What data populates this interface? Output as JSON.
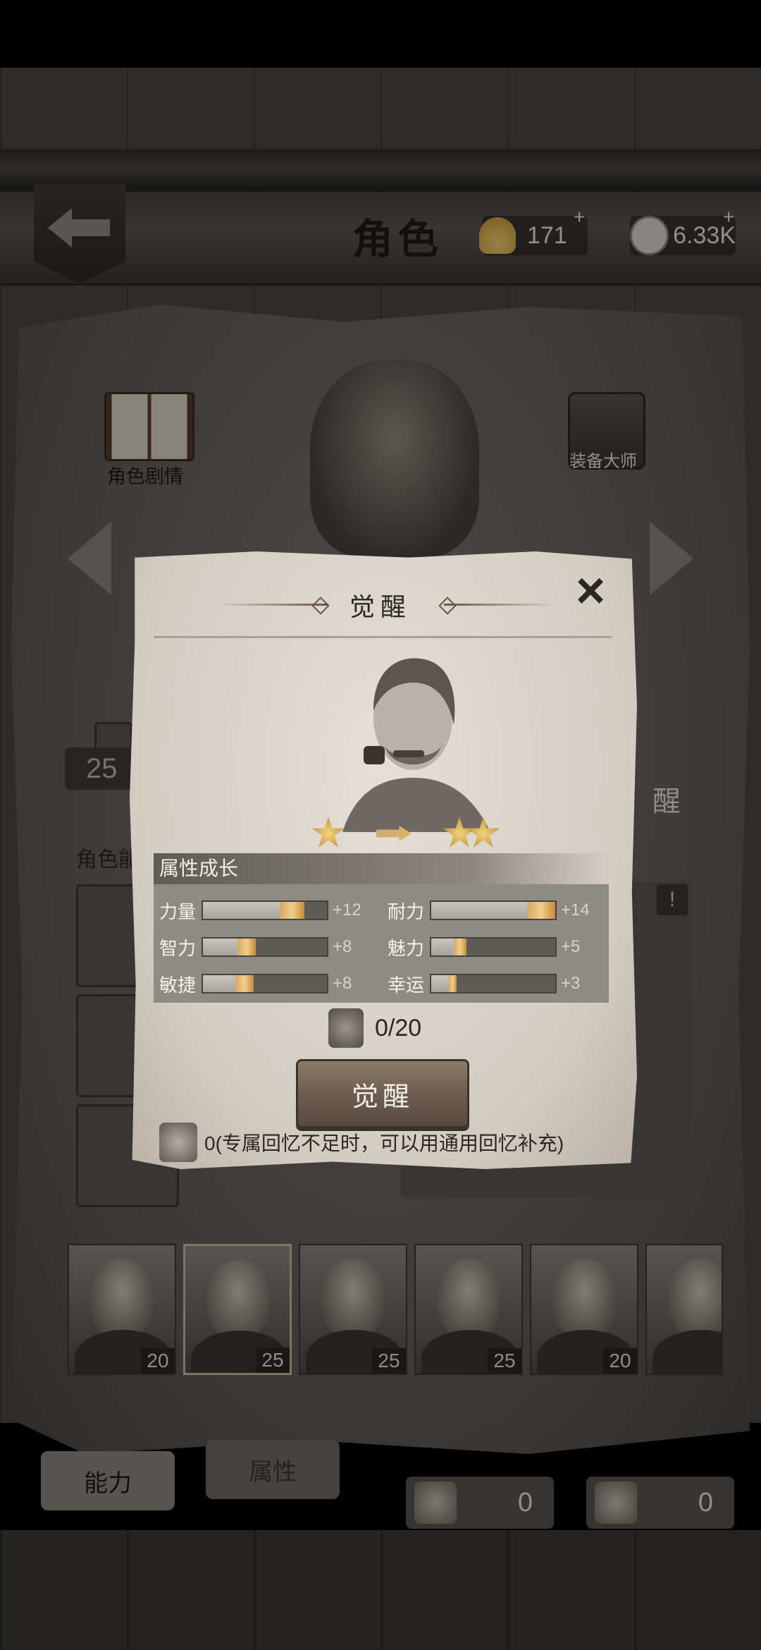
{
  "header": {
    "title": "角色",
    "shells": "171",
    "coins": "6.33K",
    "plus": "+"
  },
  "side": {
    "story_label": "角色剧情",
    "equip_label": "装备大师"
  },
  "background_ui": {
    "level_badge": "25",
    "ability_label": "角色能",
    "awaken_partial": "醒",
    "alert": "!"
  },
  "roster": [
    {
      "level": "20"
    },
    {
      "level": "25"
    },
    {
      "level": "25"
    },
    {
      "level": "25"
    },
    {
      "level": "20"
    },
    {
      "level": ""
    }
  ],
  "bottom": {
    "tab_ability": "能力",
    "tab_attr": "属性",
    "counter_1": "0",
    "counter_2": "0"
  },
  "modal": {
    "title": "觉醒",
    "close": "×",
    "attr_header": "属性成长",
    "stars_from": 1,
    "stars_to": 2,
    "attributes": [
      {
        "label": "力量",
        "bonus": "+12",
        "base": 0.62,
        "gain": 0.2
      },
      {
        "label": "耐力",
        "bonus": "+14",
        "base": 0.77,
        "gain": 0.23
      },
      {
        "label": "智力",
        "bonus": "+8",
        "base": 0.28,
        "gain": 0.15
      },
      {
        "label": "魅力",
        "bonus": "+5",
        "base": 0.18,
        "gain": 0.1
      },
      {
        "label": "敏捷",
        "bonus": "+8",
        "base": 0.26,
        "gain": 0.15
      },
      {
        "label": "幸运",
        "bonus": "+3",
        "base": 0.14,
        "gain": 0.06
      }
    ],
    "memory_count": "0/20",
    "awaken_button": "觉醒",
    "note": "0(专属回忆不足时，可以用通用回忆补充)"
  }
}
